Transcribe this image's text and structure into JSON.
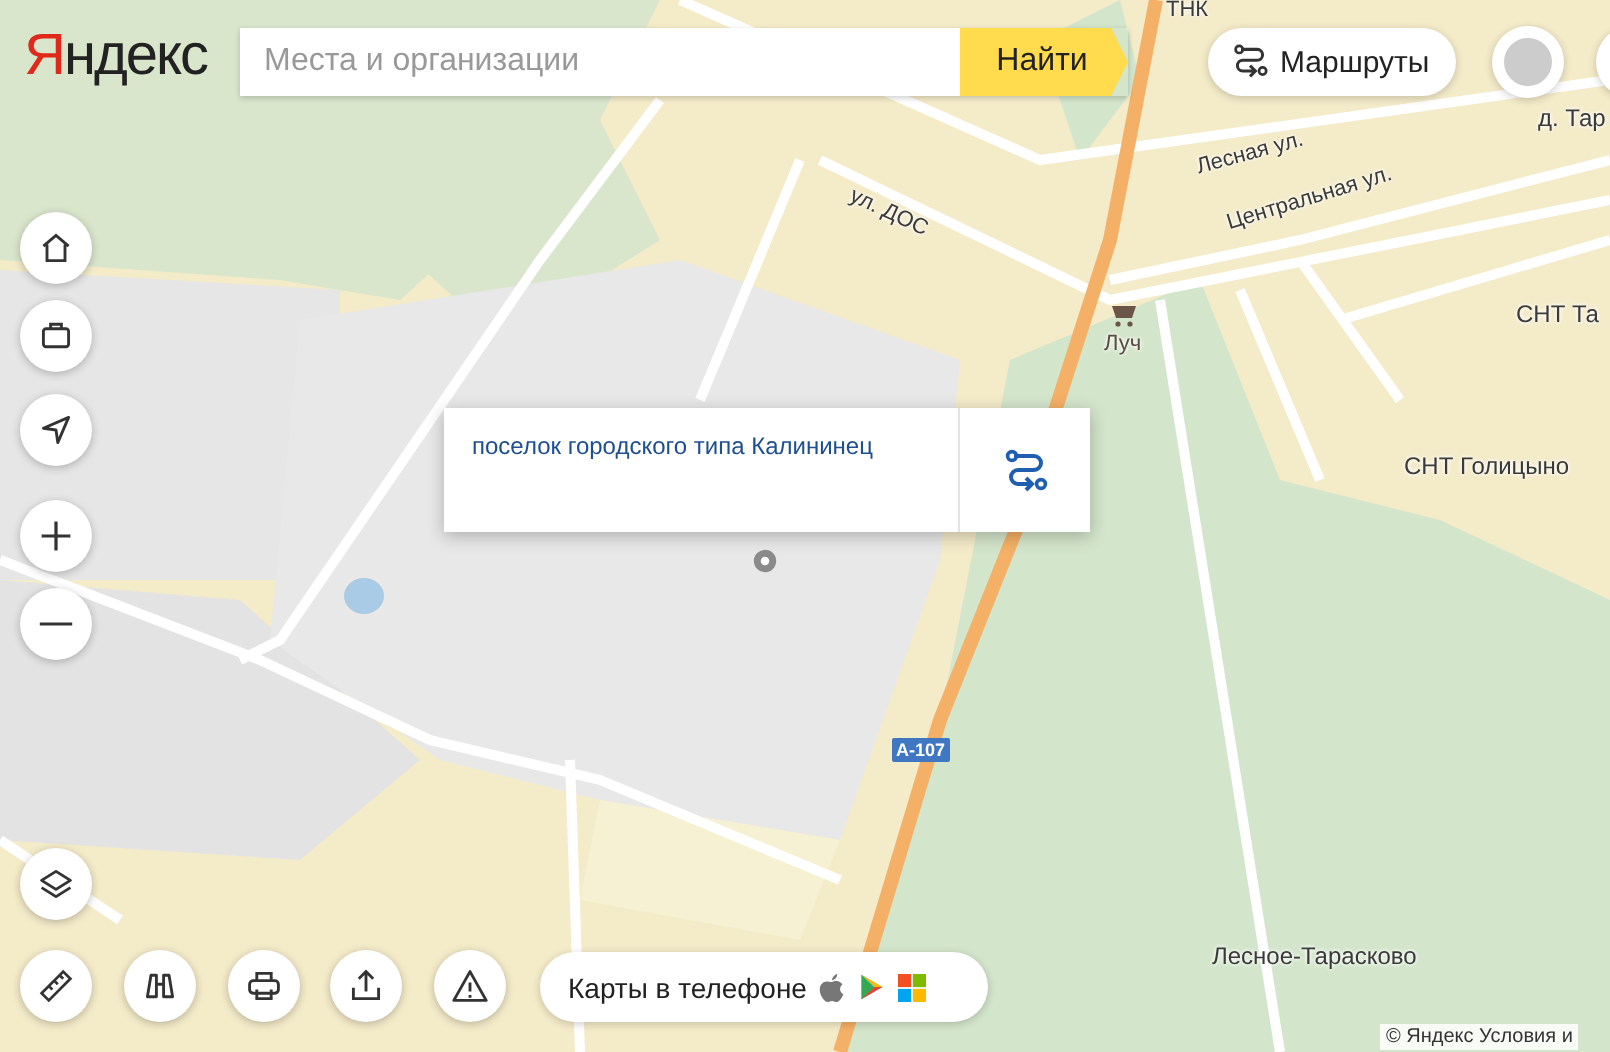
{
  "header": {
    "logo": "Яндекс",
    "search": {
      "placeholder": "Места и организации"
    },
    "search_button": "Найти",
    "routes_button": "Маршруты"
  },
  "map": {
    "labels": [
      {
        "text": "ТНК",
        "kind": "place"
      },
      {
        "text": "д. Тар",
        "kind": "place"
      },
      {
        "text": "ул. ДОС",
        "kind": "street"
      },
      {
        "text": "Лесная ул.",
        "kind": "street"
      },
      {
        "text": "Центральная ул.",
        "kind": "street"
      },
      {
        "text": "Луч",
        "kind": "poi"
      },
      {
        "text": "СНТ Та",
        "kind": "place"
      },
      {
        "text": "СНТ Голицыно",
        "kind": "place"
      },
      {
        "text": "А-107",
        "kind": "road"
      },
      {
        "text": "Лесное-Тарасково",
        "kind": "place"
      }
    ]
  },
  "popup": {
    "title": "поселок городского типа Калининец"
  },
  "bottom_bar": {
    "app_promo": "Карты в телефоне"
  },
  "copyright": "© Яндекс Условия и"
}
